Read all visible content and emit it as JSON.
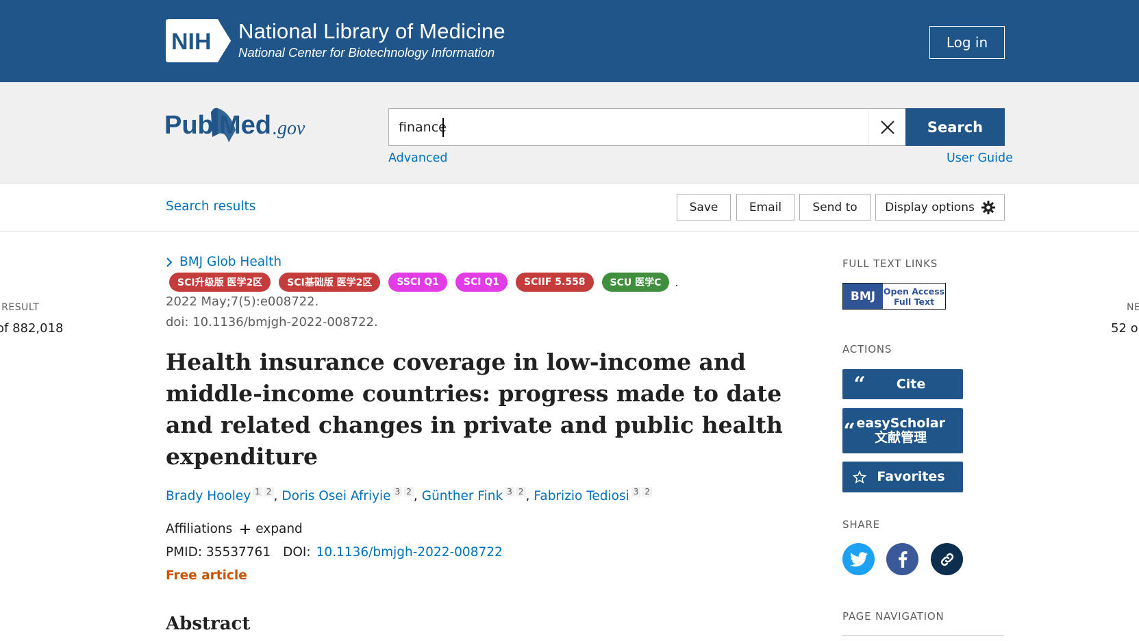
{
  "nih": {
    "logo_text": "NIH",
    "title": "National Library of Medicine",
    "subtitle": "National Center for Biotechnology Information",
    "login_label": "Log in"
  },
  "search": {
    "logo_pub": "Pub",
    "logo_med": "Med",
    "logo_gov": ".gov",
    "query": "finance",
    "button_label": "Search",
    "advanced_label": "Advanced",
    "user_guide_label": "User Guide"
  },
  "toolbar": {
    "search_results_label": "Search results",
    "save_label": "Save",
    "email_label": "Email",
    "send_to_label": "Send to",
    "display_options_label": "Display options"
  },
  "paging": {
    "prev_label": "/ RESULT",
    "prev_count": "of 882,018",
    "next_label": "NE",
    "next_count": "52 o"
  },
  "article": {
    "journal": "BMJ Glob Health",
    "badges": [
      {
        "label": "SCI升级版 医学2区",
        "color": "#c43c3c"
      },
      {
        "label": "SCI基础版 医学2区",
        "color": "#c43c3c"
      },
      {
        "label": "SSCI Q1",
        "color": "#e23ce6"
      },
      {
        "label": "SCI Q1",
        "color": "#e23ce6"
      },
      {
        "label": "SCIIF 5.558",
        "color": "#c43c3c"
      },
      {
        "label": "SCU 医学C",
        "color": "#3f8f3f"
      }
    ],
    "badge_trailing": ".",
    "citation": "2022 May;7(5):e008722.",
    "doi_text": "doi: 10.1136/bmjgh-2022-008722.",
    "title": "Health insurance coverage in low-income and middle-income countries: progress made to date and related changes in private and public health expenditure",
    "authors": [
      {
        "name": "Brady Hooley",
        "affs": [
          "1",
          "2"
        ]
      },
      {
        "name": "Doris Osei Afriyie",
        "affs": [
          "3",
          "2"
        ]
      },
      {
        "name": "Günther Fink",
        "affs": [
          "3",
          "2"
        ]
      },
      {
        "name": "Fabrizio Tediosi",
        "affs": [
          "3",
          "2"
        ]
      }
    ],
    "affiliations_label": "Affiliations",
    "expand_label": "expand",
    "pmid_text": "PMID: 35537761",
    "doi_label": "DOI:",
    "doi_link": "10.1136/bmjgh-2022-008722",
    "free_label": "Free article",
    "abstract_heading": "Abstract"
  },
  "sidebar": {
    "full_text_label": "FULL TEXT LINKS",
    "bmj_logo": "BMJ",
    "bmj_open_access": "Open Access",
    "bmj_full_text": "Full Text",
    "actions_label": "ACTIONS",
    "cite_label": "Cite",
    "easyscholar_line1": "easyScholar",
    "easyscholar_line2": "文献管理",
    "favorites_label": "Favorites",
    "share_label": "SHARE",
    "page_nav_label": "PAGE NAVIGATION"
  },
  "colors": {
    "nih_blue": "#20558a",
    "link_blue": "#0071bc",
    "free_orange": "#cd5400",
    "twitter": "#1da1f2",
    "facebook": "#3b5998",
    "permalink": "#0d2f4f"
  }
}
